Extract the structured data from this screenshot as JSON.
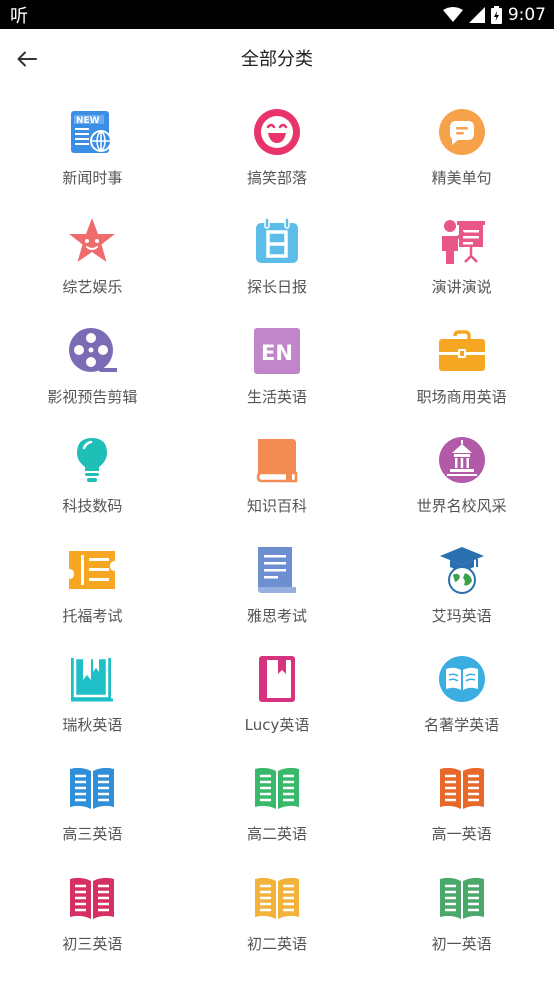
{
  "status_bar": {
    "app_glyph": "听",
    "time": "9:07"
  },
  "header": {
    "title": "全部分类"
  },
  "categories": [
    {
      "label": "新闻时事",
      "icon": "news-icon",
      "color": "#3a8ee6"
    },
    {
      "label": "搞笑部落",
      "icon": "laughing-face-icon",
      "color": "#e8336b"
    },
    {
      "label": "精美单句",
      "icon": "speech-bubble-icon",
      "color": "#f5a24a"
    },
    {
      "label": "综艺娱乐",
      "icon": "star-face-icon",
      "color": "#f06c6c"
    },
    {
      "label": "探长日报",
      "icon": "calendar-icon",
      "color": "#5bbde8"
    },
    {
      "label": "演讲演说",
      "icon": "presenter-icon",
      "color": "#e8568a"
    },
    {
      "label": "影视预告剪辑",
      "icon": "film-reel-icon",
      "color": "#7b6bb4"
    },
    {
      "label": "生活英语",
      "icon": "en-badge-icon",
      "color": "#c186c9"
    },
    {
      "label": "职场商用英语",
      "icon": "briefcase-icon",
      "color": "#f5a623"
    },
    {
      "label": "科技数码",
      "icon": "lightbulb-icon",
      "color": "#1fbfb8"
    },
    {
      "label": "知识百科",
      "icon": "book-icon",
      "color": "#f28b54"
    },
    {
      "label": "世界名校风采",
      "icon": "school-icon",
      "color": "#b25aa8"
    },
    {
      "label": "托福考试",
      "icon": "ticket-icon",
      "color": "#f5a623"
    },
    {
      "label": "雅思考试",
      "icon": "document-icon",
      "color": "#6c8fd0"
    },
    {
      "label": "艾玛英语",
      "icon": "graduation-globe-icon",
      "color": "#2a6fb0"
    },
    {
      "label": "瑞秋英语",
      "icon": "bookmark-book-icon",
      "color": "#1fbfc8"
    },
    {
      "label": "Lucy英语",
      "icon": "notebook-icon",
      "color": "#d6337f"
    },
    {
      "label": "名著学英语",
      "icon": "open-book-circle-icon",
      "color": "#3aaee0"
    },
    {
      "label": "高三英语",
      "icon": "open-book-icon",
      "color": "#2f8fd8"
    },
    {
      "label": "高二英语",
      "icon": "open-book-icon",
      "color": "#38b86a"
    },
    {
      "label": "高一英语",
      "icon": "open-book-icon",
      "color": "#e8682a"
    },
    {
      "label": "初三英语",
      "icon": "open-book-icon",
      "color": "#d62f63"
    },
    {
      "label": "初二英语",
      "icon": "open-book-icon",
      "color": "#f3b23a"
    },
    {
      "label": "初一英语",
      "icon": "open-book-icon",
      "color": "#4aa86a"
    }
  ]
}
